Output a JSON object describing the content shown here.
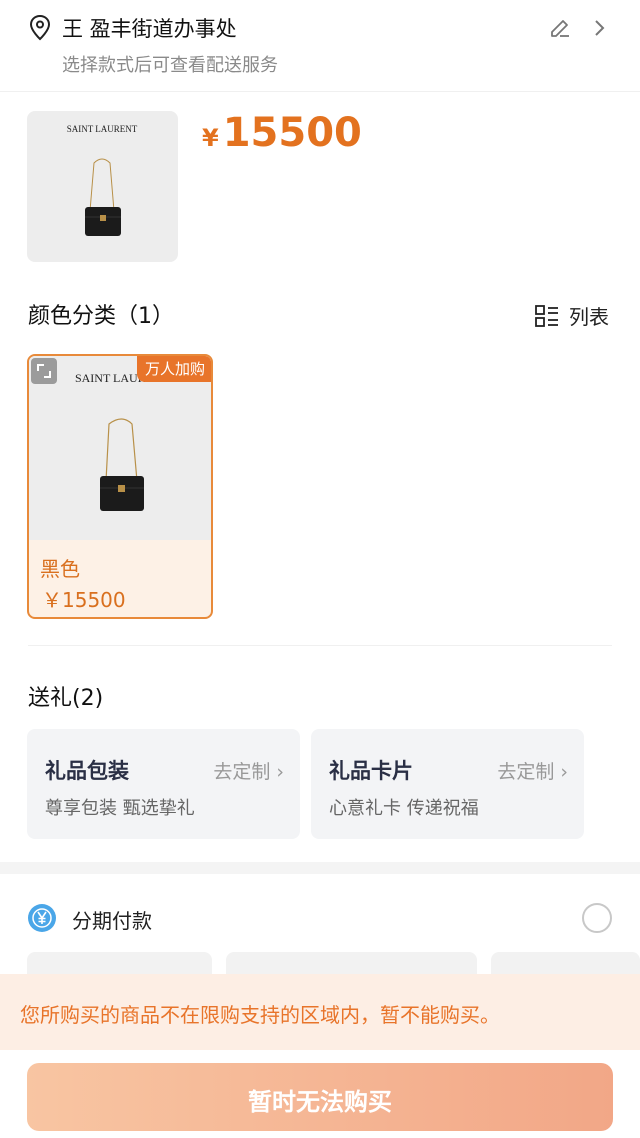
{
  "address": {
    "name": "王 盈丰街道办事处",
    "subtitle": "选择款式后可查看配送服务"
  },
  "product": {
    "brand_logo": "SAINT LAURENT",
    "currency": "¥",
    "price": "15500"
  },
  "color_section": {
    "title": "颜色分类（1）",
    "list_view_label": "列表",
    "options": [
      {
        "tag": "万人加购",
        "name": "黑色",
        "price": "￥15500",
        "brand_logo": "SAINT LAURENT",
        "selected": true
      }
    ]
  },
  "gift_section": {
    "title": "送礼(2)",
    "items": [
      {
        "title": "礼品包装",
        "action": "去定制",
        "desc": "尊享包装 甄选挚礼"
      },
      {
        "title": "礼品卡片",
        "action": "去定制",
        "desc": "心意礼卡 传递祝福"
      }
    ]
  },
  "installment": {
    "label": "分期付款"
  },
  "warning": {
    "text": "您所购买的商品不在限购支持的区域内，暂不能购买。"
  },
  "buy_button": {
    "label": "暂时无法购买"
  },
  "colors": {
    "accent": "#e3721f",
    "card_border": "#e88a3a",
    "warning_bg": "#fdeee4",
    "button_gradient_start": "#f8c5a2",
    "button_gradient_end": "#f2a787"
  },
  "icons": [
    "location-pin-icon",
    "edit-pencil-icon",
    "chevron-right-icon",
    "list-view-icon",
    "expand-icon",
    "installment-yen-icon",
    "radio-icon"
  ]
}
